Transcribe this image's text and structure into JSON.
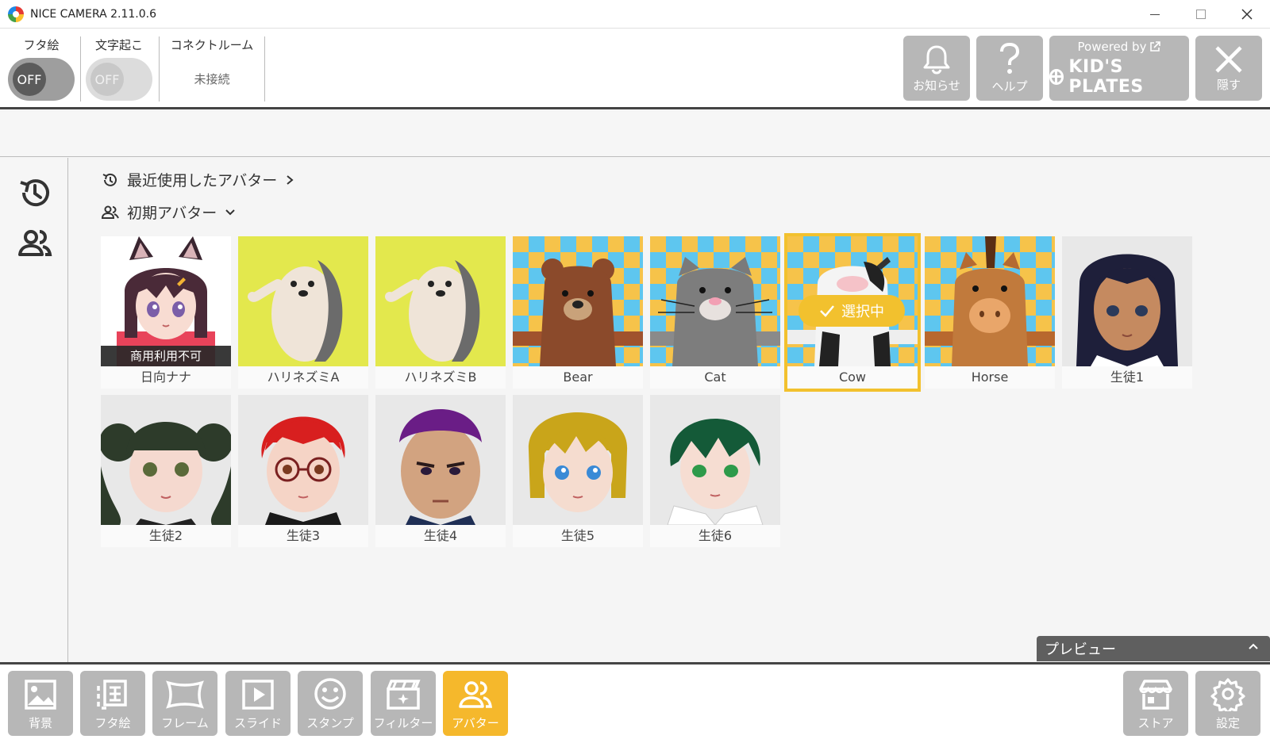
{
  "window": {
    "title": "NICE CAMERA 2.11.0.6"
  },
  "toolbar": {
    "futae": {
      "label": "フタ絵",
      "toggle": "OFF"
    },
    "transcribe": {
      "label": "文字起こ",
      "toggle": "OFF"
    },
    "connect_room": {
      "label": "コネクトルーム",
      "status": "未接続"
    },
    "notice_label": "お知らせ",
    "help_label": "ヘルプ",
    "powered_by": "Powered by",
    "brand": "KID'S PLATES",
    "hide_label": "隠す"
  },
  "sections": {
    "recent": "最近使用したアバター",
    "initial": "初期アバター"
  },
  "avatars": [
    {
      "name": "日向ナナ",
      "badge": "商用利用不可"
    },
    {
      "name": "ハリネズミA"
    },
    {
      "name": "ハリネズミB"
    },
    {
      "name": "Bear"
    },
    {
      "name": "Cat"
    },
    {
      "name": "Cow",
      "selected_label": "選択中"
    },
    {
      "name": "Horse"
    },
    {
      "name": "生徒1"
    },
    {
      "name": "生徒2"
    },
    {
      "name": "生徒3"
    },
    {
      "name": "生徒4"
    },
    {
      "name": "生徒5"
    },
    {
      "name": "生徒6"
    }
  ],
  "preview": {
    "label": "プレビュー"
  },
  "bottom_nav": {
    "background": "背景",
    "futae": "フタ絵",
    "frame": "フレーム",
    "slide": "スライド",
    "stamp": "スタンプ",
    "filter": "フィルター",
    "avatar": "アバター",
    "store": "ストア",
    "settings": "設定"
  },
  "colors": {
    "accent": "#f5b82c",
    "button_grey": "#b7b7b7"
  }
}
